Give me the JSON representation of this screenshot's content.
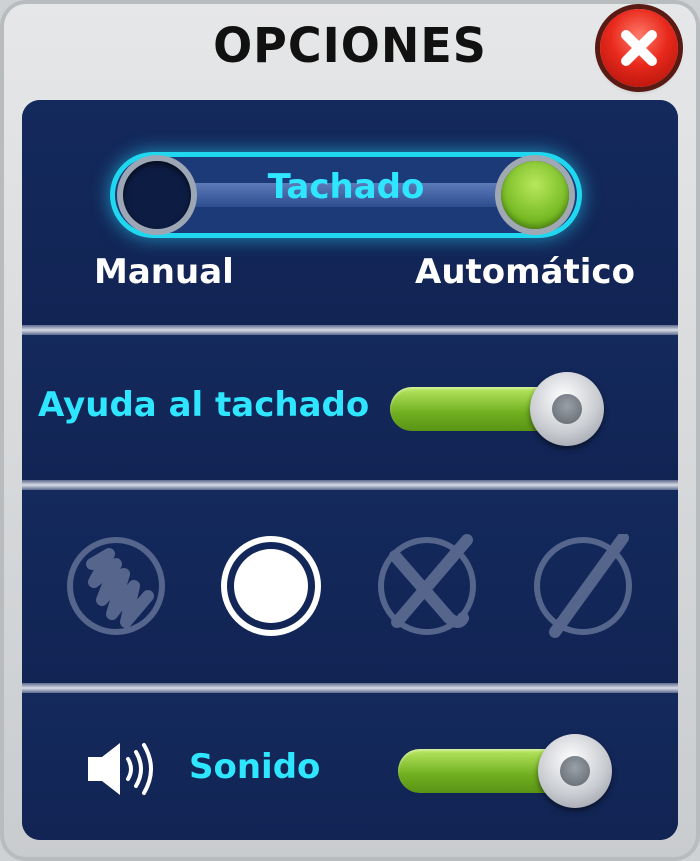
{
  "dialog": {
    "title": "OPCIONES",
    "close_icon": "close-icon"
  },
  "strikethrough_mode": {
    "label": "Tachado",
    "left_option": "Manual",
    "right_option": "Automático",
    "selected": "Automático"
  },
  "strike_help": {
    "label": "Ayuda al tachado",
    "enabled": true
  },
  "strike_styles": {
    "options": [
      "scribble-style-icon",
      "circle-style-icon",
      "cross-style-icon",
      "slash-style-icon"
    ],
    "selected_index": 1
  },
  "sound": {
    "icon": "speaker-icon",
    "label": "Sonido",
    "enabled": true
  },
  "colors": {
    "accent_cyan": "#2ee6ff",
    "panel_blue": "#13275a",
    "toggle_green": "#7dc22a",
    "close_red": "#e8291c"
  }
}
